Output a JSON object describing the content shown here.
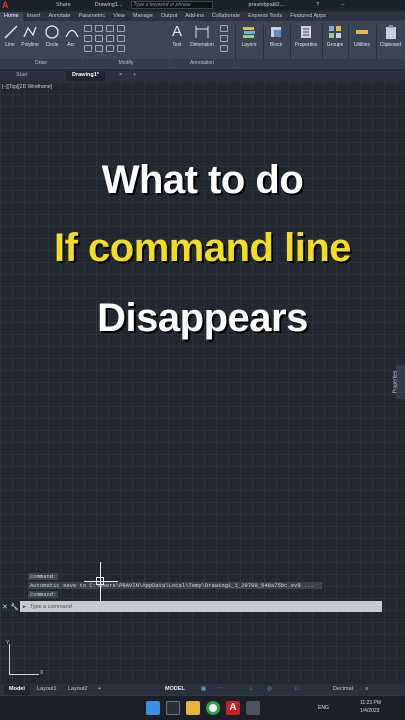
{
  "titlebar": {
    "app_logo": "A",
    "share": "Share",
    "document": "Drawing1...",
    "search_placeholder": "Type a keyword or phrase",
    "user": "pravinbpatil2...",
    "help": "?"
  },
  "ribbon_tabs": [
    "Home",
    "Insert",
    "Annotate",
    "Parametric",
    "View",
    "Manage",
    "Output",
    "Add-ins",
    "Collaborate",
    "Express Tools",
    "Featured Apps"
  ],
  "ribbon": {
    "draw_tools": [
      "Line",
      "Polyline",
      "Circle",
      "Arc"
    ],
    "text": "Text",
    "dimension": "Dimension",
    "layers": "Layers",
    "block": "Block",
    "properties": "Properties",
    "groups": "Groups",
    "utilities": "Utilities",
    "clipboard": "Clipboard",
    "groups_bar": {
      "draw": "Draw",
      "modify": "Modify",
      "annotation": "Annotation"
    }
  },
  "doc_tabs": {
    "start": "Start",
    "drawing": "Drawing1*",
    "add": "+"
  },
  "viewport_label": "[–][Top][2D Wireframe]",
  "headline": {
    "line1": "What to do",
    "line2": "If command line",
    "line3": "Disappears"
  },
  "side_panel": "Properties",
  "command_history": {
    "line1": "Command:",
    "line2": "Automatic save to C:\\Users\\PRAVIN\\AppData\\Local\\Temp\\Drawing1_1_29798_548a75bc.sv$ ...",
    "line3": "Command:"
  },
  "command_line": {
    "placeholder": "Type a command",
    "close": "✕",
    "customize": "🔧",
    "prompt_icon": "▸"
  },
  "ucs": {
    "x": "X",
    "y": "Y"
  },
  "layout_tabs": [
    "Model",
    "Layout1",
    "Layout2"
  ],
  "layout_add": "+",
  "status": {
    "model": "MODEL",
    "units": "Decimal"
  },
  "taskbar": {
    "lang": "ENG",
    "time": "11:23 PM",
    "date": "1/4/2023"
  },
  "colors": {
    "accent_yellow": "#f4de1a",
    "autocad_red": "#e1322b"
  }
}
